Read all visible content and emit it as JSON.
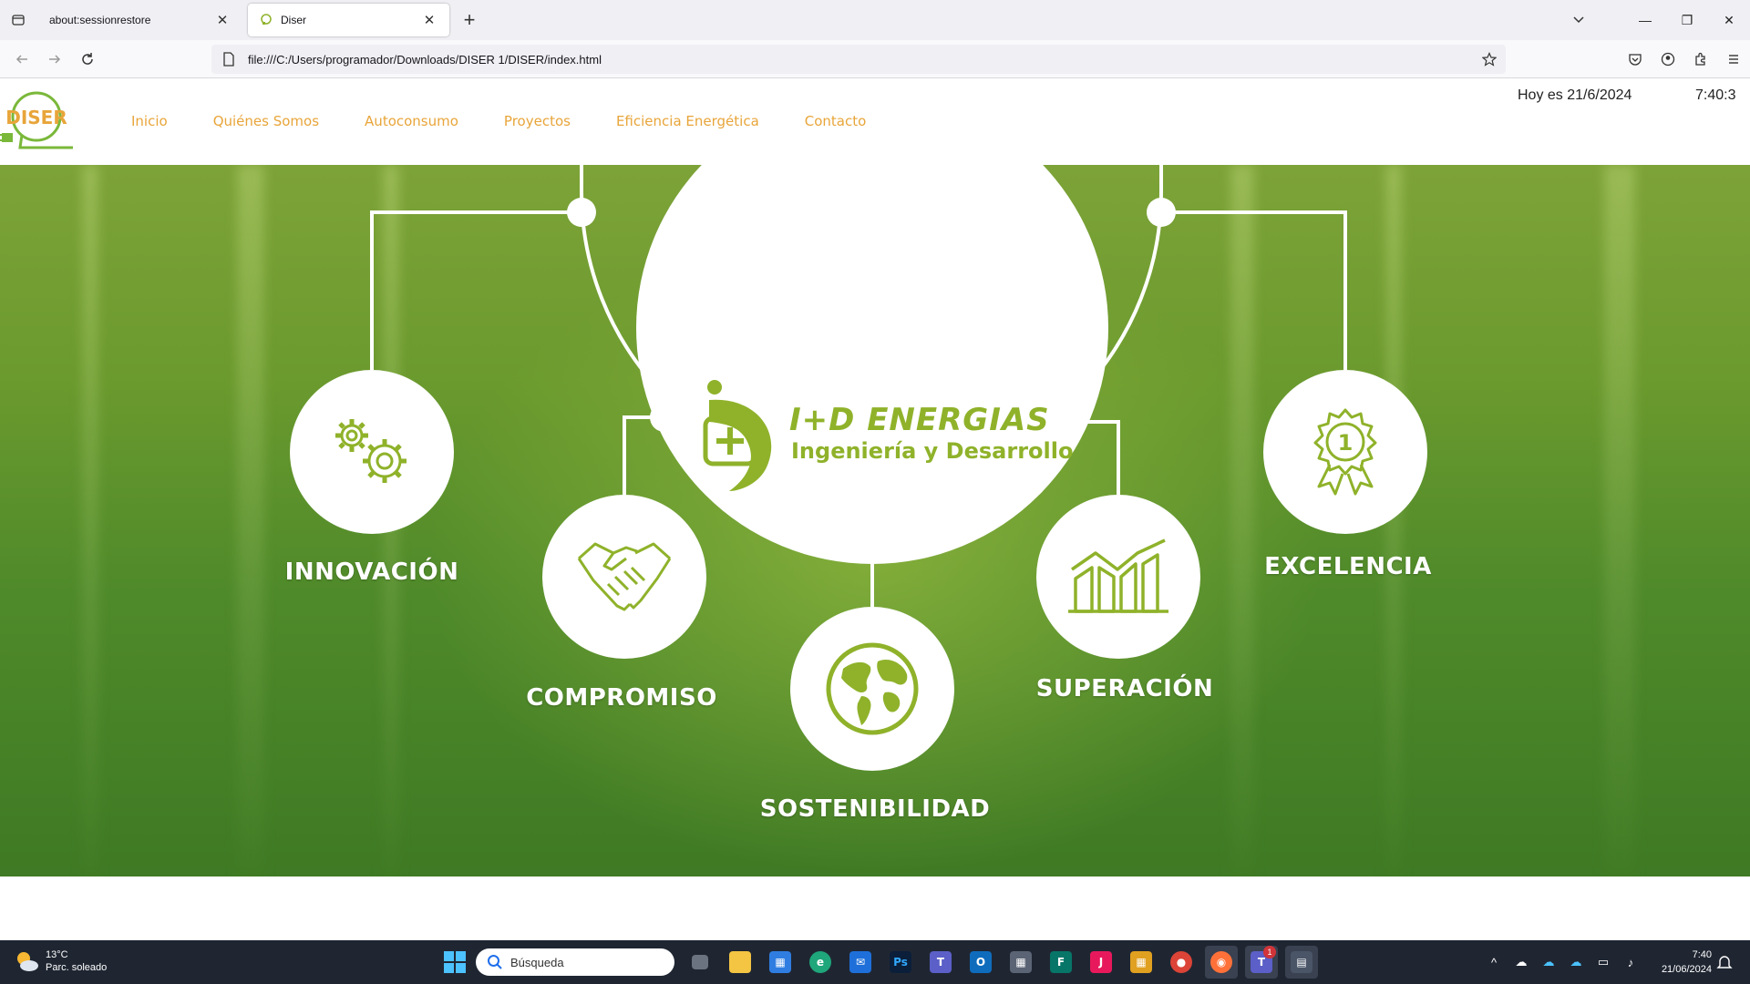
{
  "browser": {
    "tabs": [
      {
        "title": "about:sessionrestore",
        "active": false
      },
      {
        "title": "Diser",
        "active": true
      }
    ],
    "url": "file:///C:/Users/programador/Downloads/DISER 1/DISER/index.html"
  },
  "site": {
    "logo_text": "DISER",
    "nav": [
      "Inicio",
      "Quiénes Somos",
      "Autoconsumo",
      "Proyectos",
      "Eficiencia Energética",
      "Contacto"
    ],
    "date_text": "Hoy es 21/6/2024",
    "clock_text": "7:40:3",
    "brand": {
      "name": "I+D ENERGIAS",
      "tagline": "Ingeniería y Desarrollo",
      "color": "#8fb22a"
    },
    "values": [
      {
        "label": "INNOVACIÓN",
        "icon": "gears-icon"
      },
      {
        "label": "COMPROMISO",
        "icon": "handshake-icon"
      },
      {
        "label": "SOSTENIBILIDAD",
        "icon": "globe-icon"
      },
      {
        "label": "SUPERACIÓN",
        "icon": "growth-chart-icon"
      },
      {
        "label": "EXCELENCIA",
        "icon": "award-badge-icon"
      }
    ],
    "award_number": "1",
    "accent_color": "#e8a53a"
  },
  "taskbar": {
    "weather_temp": "13°C",
    "weather_desc": "Parc. soleado",
    "search_placeholder": "Búsqueda",
    "time": "7:40",
    "date": "21/06/2024",
    "teams_badge": "1"
  }
}
